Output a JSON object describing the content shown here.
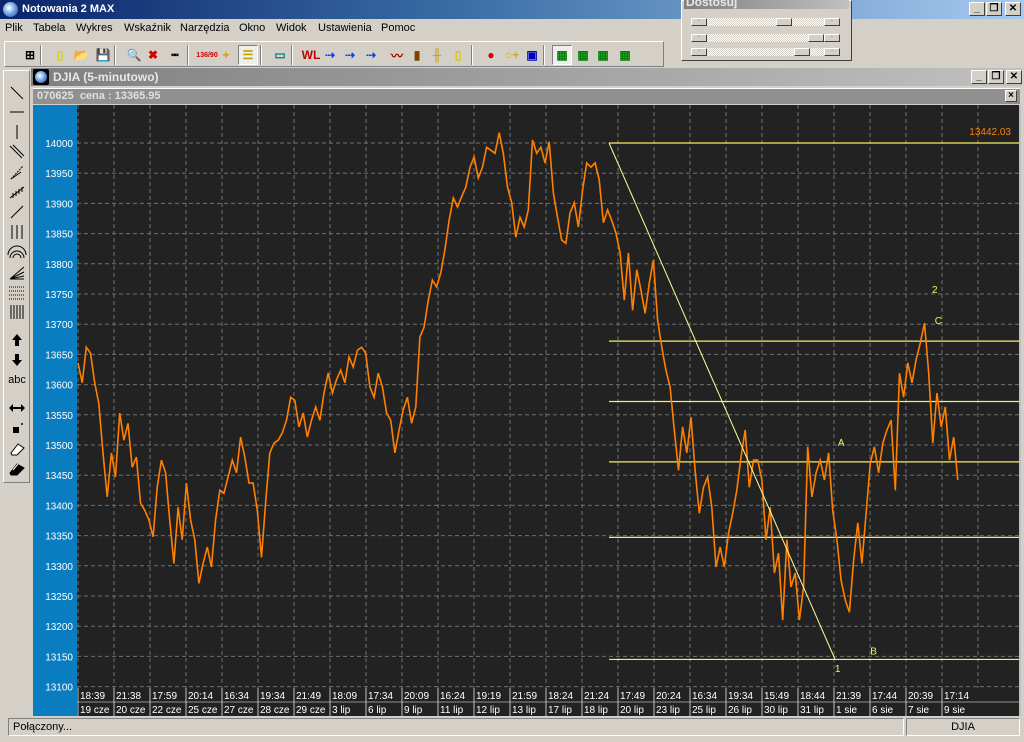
{
  "app": {
    "title": "Notowania 2 MAX",
    "buttons": {
      "minimize": "_",
      "restore": "❐",
      "close": "✕"
    }
  },
  "menu": [
    "Plik",
    "Tabela",
    "Wykres",
    "Wskaźnik",
    "Narzędzia",
    "Okno",
    "Widok",
    "Ustawienia",
    "Pomoc"
  ],
  "toolbar": [
    {
      "name": "grid-layout",
      "glyph": "⊞"
    },
    {
      "name": "new-file",
      "glyph": "▯"
    },
    {
      "name": "open-folder",
      "glyph": "📂"
    },
    {
      "name": "save",
      "glyph": "💾"
    },
    {
      "name": "zoom-magnifier",
      "glyph": "🔍"
    },
    {
      "name": "delete-zoom",
      "glyph": "✖"
    },
    {
      "name": "ruler",
      "glyph": "┅"
    },
    {
      "name": "scale-numbers",
      "glyph": "136/90"
    },
    {
      "name": "crosshair",
      "glyph": "+"
    },
    {
      "name": "lines-settings",
      "glyph": "☰"
    },
    {
      "name": "data-window",
      "glyph": "▭"
    },
    {
      "name": "wl-indicator",
      "glyph": "WL"
    },
    {
      "name": "trend-arrow-1",
      "glyph": "⇢"
    },
    {
      "name": "trend-arrow-2",
      "glyph": "⇢"
    },
    {
      "name": "trend-arrow-3",
      "glyph": "⇢"
    },
    {
      "name": "line-chart",
      "glyph": "〰"
    },
    {
      "name": "bar-chart",
      "glyph": "▮"
    },
    {
      "name": "ohlc-chart",
      "glyph": "╫"
    },
    {
      "name": "candlestick-chart",
      "glyph": "▯"
    },
    {
      "name": "traffic-light",
      "glyph": "●"
    },
    {
      "name": "add-signal",
      "glyph": "○+"
    },
    {
      "name": "add-alert",
      "glyph": "▣"
    },
    {
      "name": "layout-1",
      "glyph": "▦"
    },
    {
      "name": "layout-2",
      "glyph": "▦"
    },
    {
      "name": "layout-3",
      "glyph": "▦"
    },
    {
      "name": "layout-4",
      "glyph": "▦"
    }
  ],
  "adjust_panel": {
    "title": "Dostosuj",
    "button_glyph": "·",
    "sliders": [
      0.68,
      1.0,
      0.86
    ]
  },
  "left_tools": [
    "trend-line",
    "horizontal-line",
    "vertical-line",
    "parallel-lines",
    "speed-lines",
    "gann-fan",
    "ray-line",
    "triple-vertical",
    "fibonacci-arcs",
    "fibonacci-fan",
    "fibonacci-retracement",
    "fibonacci-time",
    "up-arrow",
    "down-arrow",
    "text-tool",
    "horizontal-move",
    "move-point",
    "eraser",
    "erase-all"
  ],
  "left_tools_text": "abc",
  "child_window": {
    "title": "DJIA (5-minutowo)"
  },
  "info": {
    "text": "070625  cena : 13365.95",
    "close": "×"
  },
  "status": {
    "connection": "Połączony...",
    "symbol": "DJIA"
  },
  "chart_data": {
    "type": "line",
    "title": "DJIA (5-minutowo)",
    "ylim": [
      13100,
      14000
    ],
    "yticks": [
      14000,
      13950,
      13900,
      13850,
      13800,
      13750,
      13700,
      13650,
      13600,
      13550,
      13500,
      13450,
      13400,
      13350,
      13300,
      13250,
      13200,
      13150,
      13100
    ],
    "xticks_time": [
      "18:39",
      "21:38",
      "17:59",
      "20:14",
      "16:34",
      "19:34",
      "21:49",
      "18:09",
      "17:34",
      "20:09",
      "16:24",
      "19:19",
      "21:59",
      "18:24",
      "21:24",
      "17:49",
      "20:24",
      "16:34",
      "19:34",
      "15:49",
      "18:44",
      "21:39",
      "17:44",
      "20:39",
      "17:14"
    ],
    "xticks_date": [
      "19 cze",
      "20 cze",
      "22 cze",
      "25 cze",
      "27 cze",
      "28 cze",
      "29 cze",
      "3 lip",
      "6 lip",
      "9 lip",
      "11 lip",
      "12 lip",
      "13 lip",
      "17 lip",
      "18 lip",
      "20 lip",
      "23 lip",
      "25 lip",
      "26 lip",
      "30 lip",
      "31 lip",
      "1 sie",
      "6 sie",
      "7 sie",
      "9 sie"
    ],
    "grid": true,
    "series": [
      {
        "name": "DJIA",
        "color": "#ff8000",
        "x_range_slots": [
          0,
          24.44
        ],
        "values": [
          13636,
          13603,
          13662,
          13652,
          13603,
          13569,
          13487,
          13414,
          13487,
          13447,
          13553,
          13508,
          13536,
          13463,
          13480,
          13404,
          13392,
          13376,
          13348,
          13430,
          13475,
          13454,
          13376,
          13304,
          13397,
          13343,
          13437,
          13376,
          13343,
          13271,
          13304,
          13331,
          13298,
          13376,
          13425,
          13420,
          13447,
          13475,
          13454,
          13513,
          13480,
          13437,
          13437,
          13392,
          13314,
          13404,
          13487,
          13503,
          13508,
          13520,
          13541,
          13579,
          13574,
          13530,
          13553,
          13513,
          13541,
          13563,
          13541,
          13586,
          13619,
          13586,
          13608,
          13624,
          13603,
          13646,
          13629,
          13657,
          13662,
          13652,
          13596,
          13579,
          13619,
          13596,
          13553,
          13541,
          13487,
          13525,
          13558,
          13579,
          13536,
          13563,
          13679,
          13695,
          13740,
          13773,
          13762,
          13785,
          13823,
          13872,
          13909,
          13894,
          13911,
          13927,
          13960,
          13977,
          13942,
          13960,
          13993,
          13988,
          13983,
          14017,
          13983,
          13927,
          13901,
          13844,
          13877,
          13861,
          13889,
          14005,
          13983,
          13993,
          13967,
          14002,
          13917,
          13877,
          13839,
          13834,
          13884,
          13901,
          13861,
          13922,
          13967,
          13960,
          13967,
          13939,
          13868,
          13889,
          13872,
          13851,
          13818,
          13740,
          13818,
          13723,
          13790,
          13757,
          13718,
          13768,
          13806,
          13707,
          13662,
          13624,
          13596,
          13525,
          13458,
          13530,
          13487,
          13546,
          13458,
          13387,
          13430,
          13447,
          13397,
          13298,
          13331,
          13298,
          13354,
          13387,
          13425,
          13480,
          13525,
          13430,
          13475,
          13475,
          13442,
          13343,
          13397,
          13288,
          13321,
          13210,
          13343,
          13265,
          13288,
          13210,
          13265,
          13497,
          13414,
          13454,
          13475,
          13442,
          13487,
          13392,
          13343,
          13276,
          13243,
          13223,
          13309,
          13371,
          13304,
          13387,
          13470,
          13497,
          13454,
          13503,
          13525,
          13541,
          13425,
          13619,
          13579,
          13636,
          13603,
          13641,
          13669,
          13702,
          13619,
          13503,
          13586,
          13530,
          13563,
          13475,
          13513,
          13442
        ]
      }
    ],
    "fibonacci_levels": {
      "start_slot": 14.75,
      "prices": [
        14000,
        13672,
        13572,
        13472,
        13347,
        13145
      ],
      "color": "#f8f060"
    },
    "trendline": {
      "from": [
        14.75,
        14000
      ],
      "to": [
        21.03,
        13145
      ],
      "color": "#ffff99"
    },
    "wave_labels": [
      {
        "text": "A",
        "slot": 21.2,
        "price": 13498
      },
      {
        "text": "B",
        "slot": 22.1,
        "price": 13153
      },
      {
        "text": "C",
        "slot": 23.9,
        "price": 13700
      },
      {
        "text": "1",
        "slot": 21.1,
        "price": 13124
      },
      {
        "text": "2",
        "slot": 23.8,
        "price": 13752
      }
    ],
    "value_label": "13442.03"
  }
}
